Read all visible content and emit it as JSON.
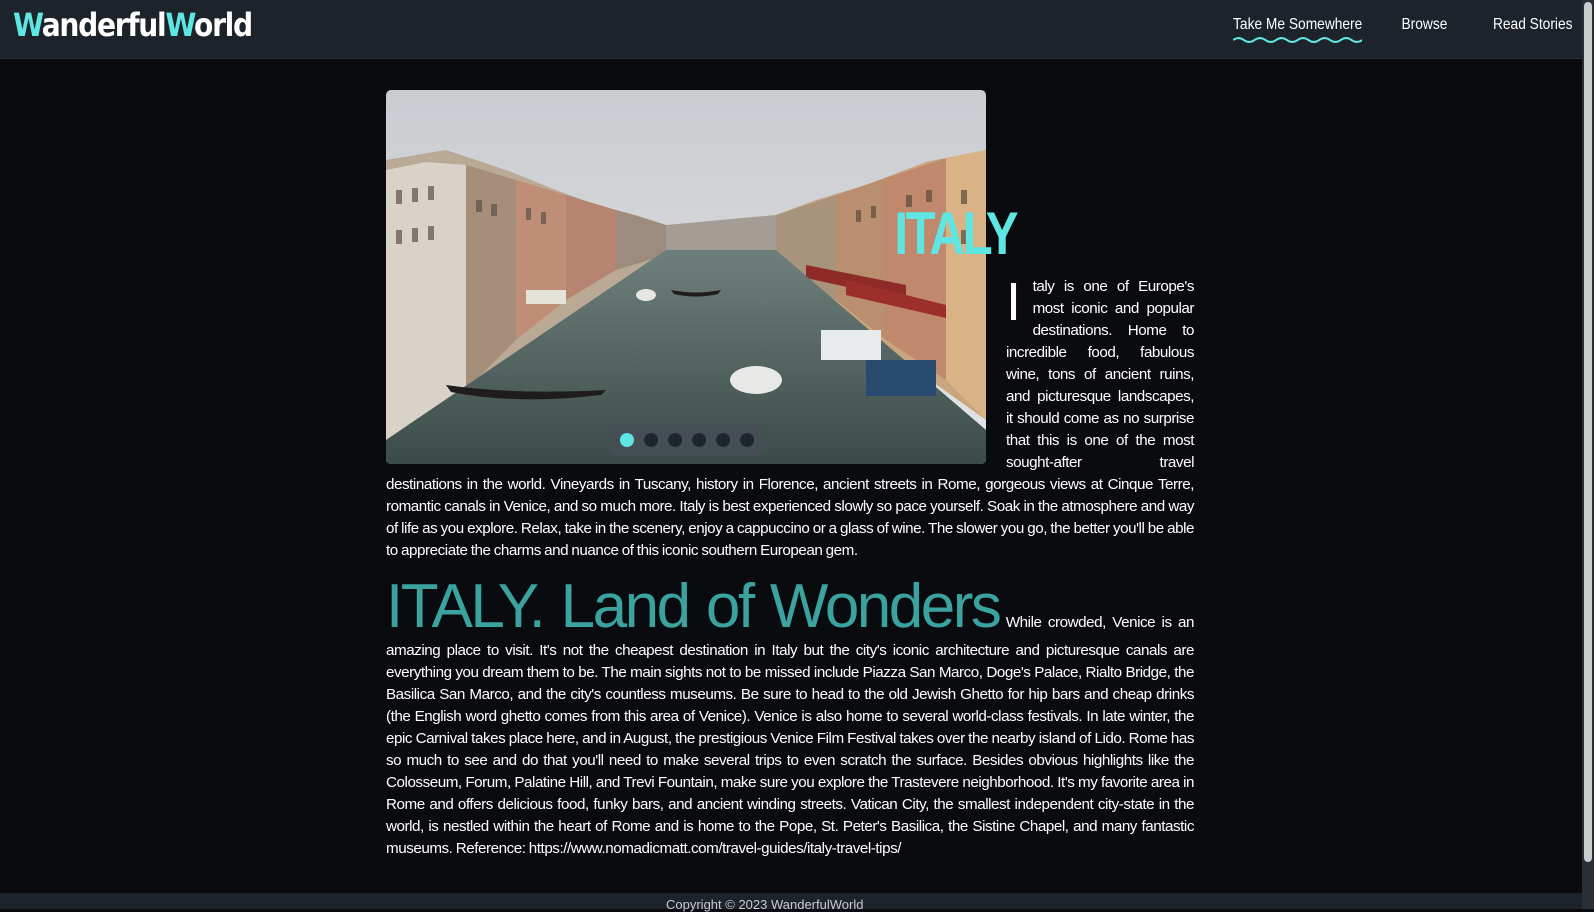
{
  "brand": {
    "part1_initial": "W",
    "part1_rest": "anderful",
    "part2_initial": "W",
    "part2_rest": "orld",
    "accent_color": "#5ee6e3"
  },
  "nav": {
    "items": [
      {
        "label": "Take Me Somewhere",
        "active": true
      },
      {
        "label": "Browse",
        "active": false
      },
      {
        "label": "Read Stories",
        "active": false
      }
    ]
  },
  "slider": {
    "image_icon": "venice-grand-canal-photo",
    "slide_count": 6,
    "active_index": 0
  },
  "article": {
    "title": "ITALY",
    "dropcap": "I",
    "intro": "taly is one of Europe's most iconic and popular destinations. Home to incredible food, fabulous wine, tons of ancient ruins, and picturesque landscapes, it should come as no surprise that this is one of the most sought-after travel destinations in the world. Vineyards in Tuscany, history in Florence, ancient streets in Rome, gorgeous views at Cinque Terre, romantic canals in Venice, and so much more. Italy is best experienced slowly so pace yourself. Soak in the atmosphere and way of life as you explore. Relax, take in the scenery, enjoy a cappuccino or a glass of wine. The slower you go, the better you'll be able to appreciate the charms and nuance of this iconic southern European gem.",
    "section_title": "ITALY. Land of Wonders",
    "section_body": "While crowded, Venice is an amazing place to visit. It's not the cheapest destination in Italy but the city's iconic architecture and picturesque canals are everything you dream them to be. The main sights not to be missed include Piazza San Marco, Doge's Palace, Rialto Bridge, the Basilica San Marco, and the city's countless museums. Be sure to head to the old Jewish Ghetto for hip bars and cheap drinks (the English word ghetto comes from this area of Venice). Venice is also home to several world-class festivals. In late winter, the epic Carnival takes place here, and in August, the prestigious Venice Film Festival takes over the nearby island of Lido. Rome has so much to see and do that you'll need to make several trips to even scratch the surface. Besides obvious highlights like the Colosseum, Forum, Palatine Hill, and Trevi Fountain, make sure you explore the Trastevere neighborhood. It's my favorite area in Rome and offers delicious food, funky bars, and ancient winding streets. Vatican City, the smallest independent city-state in the world, is nestled within the heart of Rome and is home to the Pope, St. Peter's Basilica, the Sistine Chapel, and many fantastic museums. Reference: https://www.nomadicmatt.com/travel-guides/italy-travel-tips/"
  },
  "footer": {
    "text": "Copyright © 2023 WanderfulWorld"
  }
}
